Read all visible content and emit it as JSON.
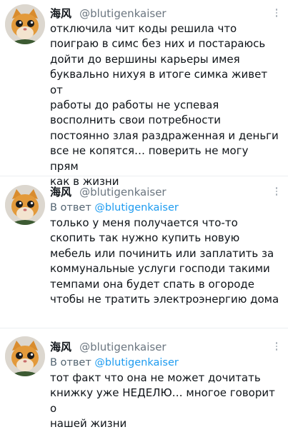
{
  "tweets": [
    {
      "author": {
        "display_name": "海风",
        "handle": "@blutigenkaiser"
      },
      "reply_to": null,
      "text": "отключила чит коды решила что\nпоиграю в симс без них и постараюсь\nдойти до вершины карьеры имея\nбуквально нихуя в итоге симка живет от\nработы до работы не успевая\nвосполнить свои потребности\nпостоянно злая раздраженная и деньги\nвсе не копятся… поверить не могу прям\nкак в жизни",
      "avatar_icon": "cat-avatar-icon",
      "menu_icon": "more-options-icon"
    },
    {
      "author": {
        "display_name": "海风",
        "handle": "@blutigenkaiser"
      },
      "reply_to": {
        "prefix": "В ответ",
        "handle": "@blutigenkaiser"
      },
      "text": "только у меня получается что-то\nскопить так нужно купить новую\nмебель или починить или заплатить за\nкоммунальные услуги господи такими\nтемпами она будет спать в огороде\nчтобы не тратить электроэнергию дома",
      "avatar_icon": "cat-avatar-icon",
      "menu_icon": "more-options-icon"
    },
    {
      "author": {
        "display_name": "海风",
        "handle": "@blutigenkaiser"
      },
      "reply_to": {
        "prefix": "В ответ",
        "handle": "@blutigenkaiser"
      },
      "text": "тот факт что она не может дочитать\nкнижку уже НЕДЕЛЮ… многое говорит о\nнашей жизни",
      "avatar_icon": "cat-avatar-icon",
      "menu_icon": "more-options-icon"
    }
  ],
  "colors": {
    "text": "#0f1419",
    "handle": "#6b7680",
    "link": "#1d9bf0",
    "divider": "#eceff1"
  }
}
